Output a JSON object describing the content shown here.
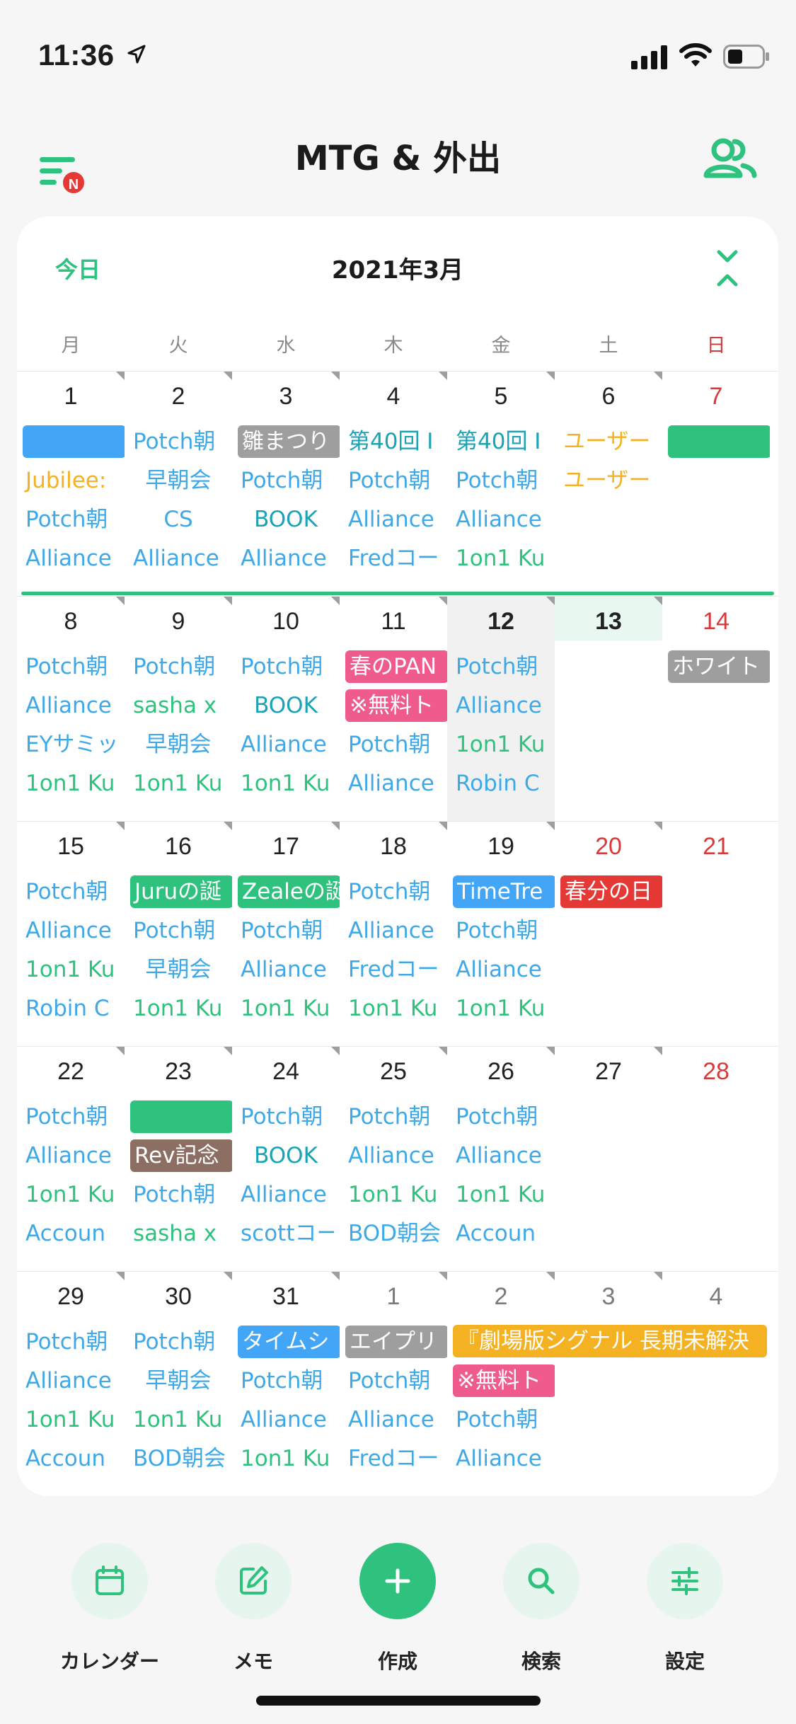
{
  "status": {
    "time": "11:36"
  },
  "header": {
    "title": "MTG & 外出",
    "menu_badge": "N"
  },
  "calendar": {
    "today_label": "今日",
    "month_title": "2021年3月",
    "dow": [
      "月",
      "火",
      "水",
      "木",
      "金",
      "土",
      "日"
    ],
    "weeks": [
      {
        "days": [
          {
            "n": "1",
            "events": [
              {
                "t": "",
                "s": "chip",
                "c": "#42a5f5"
              },
              {
                "t": "Jubilee:",
                "s": "orange"
              },
              {
                "t": "Potch朝",
                "s": "blue"
              },
              {
                "t": "Alliance",
                "s": "blue"
              }
            ]
          },
          {
            "n": "2",
            "events": [
              {
                "t": "Potch朝",
                "s": "blue"
              },
              {
                "t": "早朝会",
                "s": "blue-c"
              },
              {
                "t": "CS",
                "s": "blue-c"
              },
              {
                "t": "Alliance",
                "s": "blue"
              }
            ]
          },
          {
            "n": "3",
            "events": [
              {
                "t": "雛まつり",
                "s": "chip",
                "c": "#9e9e9e"
              },
              {
                "t": "Potch朝",
                "s": "blue"
              },
              {
                "t": "BOOK",
                "s": "teal-c"
              },
              {
                "t": "Alliance",
                "s": "blue"
              }
            ]
          },
          {
            "n": "4",
            "events": [
              {
                "t": "第40回 I",
                "s": "teal"
              },
              {
                "t": "Potch朝",
                "s": "blue"
              },
              {
                "t": "Alliance",
                "s": "blue"
              },
              {
                "t": "Fredコー",
                "s": "blue"
              }
            ]
          },
          {
            "n": "5",
            "events": [
              {
                "t": "第40回 I",
                "s": "teal"
              },
              {
                "t": "Potch朝",
                "s": "blue"
              },
              {
                "t": "Alliance",
                "s": "blue"
              },
              {
                "t": "1on1 Ku",
                "s": "green"
              }
            ]
          },
          {
            "n": "6",
            "events": [
              {
                "t": "ユーザー",
                "s": "orange"
              },
              {
                "t": "ユーザー",
                "s": "orange"
              }
            ]
          },
          {
            "n": "7",
            "events": [
              {
                "t": "",
                "s": "chip",
                "c": "#2ec27e"
              }
            ]
          }
        ]
      },
      {
        "days": [
          {
            "n": "8",
            "events": [
              {
                "t": "Potch朝",
                "s": "blue"
              },
              {
                "t": "Alliance",
                "s": "blue"
              },
              {
                "t": "EYサミッ",
                "s": "blue"
              },
              {
                "t": "1on1 Ku",
                "s": "green"
              }
            ]
          },
          {
            "n": "9",
            "events": [
              {
                "t": "Potch朝",
                "s": "blue"
              },
              {
                "t": "sasha x",
                "s": "green"
              },
              {
                "t": "早朝会",
                "s": "blue-c"
              },
              {
                "t": "1on1 Ku",
                "s": "green"
              }
            ]
          },
          {
            "n": "10",
            "events": [
              {
                "t": "Potch朝",
                "s": "blue"
              },
              {
                "t": "BOOK",
                "s": "teal-c"
              },
              {
                "t": "Alliance",
                "s": "blue"
              },
              {
                "t": "1on1 Ku",
                "s": "green"
              }
            ]
          },
          {
            "n": "11",
            "events": [
              {
                "t": "春のPAN",
                "s": "chip",
                "c": "#ef5b8c"
              },
              {
                "t": "※無料ト",
                "s": "chip",
                "c": "#ef5b8c"
              },
              {
                "t": "Potch朝",
                "s": "blue"
              },
              {
                "t": "Alliance",
                "s": "blue"
              }
            ]
          },
          {
            "n": "12",
            "events": [
              {
                "t": "Potch朝",
                "s": "blue"
              },
              {
                "t": "Alliance",
                "s": "blue"
              },
              {
                "t": "1on1 Ku",
                "s": "green"
              },
              {
                "t": "Robin C",
                "s": "blue"
              }
            ]
          },
          {
            "n": "13",
            "events": []
          },
          {
            "n": "14",
            "events": [
              {
                "t": "ホワイト",
                "s": "chip",
                "c": "#9e9e9e"
              }
            ]
          }
        ]
      },
      {
        "days": [
          {
            "n": "15",
            "events": [
              {
                "t": "Potch朝",
                "s": "blue"
              },
              {
                "t": "Alliance",
                "s": "blue"
              },
              {
                "t": "1on1 Ku",
                "s": "green"
              },
              {
                "t": "Robin C",
                "s": "blue"
              }
            ]
          },
          {
            "n": "16",
            "events": [
              {
                "t": "Juruの誕",
                "s": "chip",
                "c": "#2ec27e"
              },
              {
                "t": "Potch朝",
                "s": "blue"
              },
              {
                "t": "早朝会",
                "s": "blue-c"
              },
              {
                "t": "1on1 Ku",
                "s": "green"
              }
            ]
          },
          {
            "n": "17",
            "events": [
              {
                "t": "Zealeの誕",
                "s": "chip",
                "c": "#2ec27e"
              },
              {
                "t": "Potch朝",
                "s": "blue"
              },
              {
                "t": "Alliance",
                "s": "blue"
              },
              {
                "t": "1on1 Ku",
                "s": "green"
              }
            ]
          },
          {
            "n": "18",
            "events": [
              {
                "t": "Potch朝",
                "s": "blue"
              },
              {
                "t": "Alliance",
                "s": "blue"
              },
              {
                "t": "Fredコー",
                "s": "blue"
              },
              {
                "t": "1on1 Ku",
                "s": "green"
              }
            ]
          },
          {
            "n": "19",
            "events": [
              {
                "t": "TimeTre",
                "s": "chip",
                "c": "#42a5f5"
              },
              {
                "t": "Potch朝",
                "s": "blue"
              },
              {
                "t": "Alliance",
                "s": "blue"
              },
              {
                "t": "1on1 Ku",
                "s": "green"
              }
            ]
          },
          {
            "n": "20",
            "events": [
              {
                "t": "春分の日",
                "s": "chip",
                "c": "#e53935"
              }
            ]
          },
          {
            "n": "21",
            "events": []
          }
        ]
      },
      {
        "days": [
          {
            "n": "22",
            "events": [
              {
                "t": "Potch朝",
                "s": "blue"
              },
              {
                "t": "Alliance",
                "s": "blue"
              },
              {
                "t": "1on1 Ku",
                "s": "green"
              },
              {
                "t": "Accoun",
                "s": "blue"
              }
            ]
          },
          {
            "n": "23",
            "events": [
              {
                "t": "",
                "s": "chip",
                "c": "#2ec27e"
              },
              {
                "t": "Rev記念",
                "s": "chip",
                "c": "#8d6e63"
              },
              {
                "t": "Potch朝",
                "s": "blue"
              },
              {
                "t": "sasha x",
                "s": "green"
              }
            ]
          },
          {
            "n": "24",
            "events": [
              {
                "t": "Potch朝",
                "s": "blue"
              },
              {
                "t": "BOOK",
                "s": "teal-c"
              },
              {
                "t": "Alliance",
                "s": "blue"
              },
              {
                "t": "scottコー",
                "s": "blue"
              }
            ]
          },
          {
            "n": "25",
            "events": [
              {
                "t": "Potch朝",
                "s": "blue"
              },
              {
                "t": "Alliance",
                "s": "blue"
              },
              {
                "t": "1on1 Ku",
                "s": "green"
              },
              {
                "t": "BOD朝会",
                "s": "blue"
              }
            ]
          },
          {
            "n": "26",
            "events": [
              {
                "t": "Potch朝",
                "s": "blue"
              },
              {
                "t": "Alliance",
                "s": "blue"
              },
              {
                "t": "1on1 Ku",
                "s": "green"
              },
              {
                "t": "Accoun",
                "s": "blue"
              }
            ]
          },
          {
            "n": "27",
            "events": []
          },
          {
            "n": "28",
            "events": []
          }
        ]
      },
      {
        "days": [
          {
            "n": "29",
            "events": [
              {
                "t": "Potch朝",
                "s": "blue"
              },
              {
                "t": "Alliance",
                "s": "blue"
              },
              {
                "t": "1on1 Ku",
                "s": "green"
              },
              {
                "t": "Accoun",
                "s": "blue"
              }
            ]
          },
          {
            "n": "30",
            "events": [
              {
                "t": "Potch朝",
                "s": "blue"
              },
              {
                "t": "早朝会",
                "s": "blue-c"
              },
              {
                "t": "1on1 Ku",
                "s": "green"
              },
              {
                "t": "BOD朝会",
                "s": "blue"
              }
            ]
          },
          {
            "n": "31",
            "events": [
              {
                "t": "タイムシ",
                "s": "chip",
                "c": "#42a5f5"
              },
              {
                "t": "Potch朝",
                "s": "blue"
              },
              {
                "t": "Alliance",
                "s": "blue"
              },
              {
                "t": "1on1 Ku",
                "s": "green"
              }
            ]
          },
          {
            "n": "1",
            "events": [
              {
                "t": "エイプリ",
                "s": "chip",
                "c": "#9e9e9e"
              },
              {
                "t": "Potch朝",
                "s": "blue"
              },
              {
                "t": "Alliance",
                "s": "blue"
              },
              {
                "t": "Fredコー",
                "s": "blue"
              }
            ]
          },
          {
            "n": "2",
            "events": [
              {
                "t": "",
                "s": "skip"
              },
              {
                "t": "※無料ト",
                "s": "chip",
                "c": "#ef5b8c"
              },
              {
                "t": "Potch朝",
                "s": "blue"
              },
              {
                "t": "Alliance",
                "s": "blue"
              }
            ]
          },
          {
            "n": "3",
            "events": []
          },
          {
            "n": "4",
            "events": []
          }
        ]
      }
    ],
    "span_event": {
      "label": "『劇場版シグナル 長期未解決",
      "color": "#f4b223"
    }
  },
  "nav": {
    "items": [
      {
        "label": "カレンダー",
        "icon": "calendar-icon"
      },
      {
        "label": "メモ",
        "icon": "memo-icon"
      },
      {
        "label": "作成",
        "icon": "plus-icon"
      },
      {
        "label": "検索",
        "icon": "search-icon"
      },
      {
        "label": "設定",
        "icon": "settings-icon"
      }
    ]
  },
  "colors": {
    "accent": "#2ec27e",
    "event_blue": "#3fa9e8",
    "holiday_red": "#d63a3a"
  }
}
